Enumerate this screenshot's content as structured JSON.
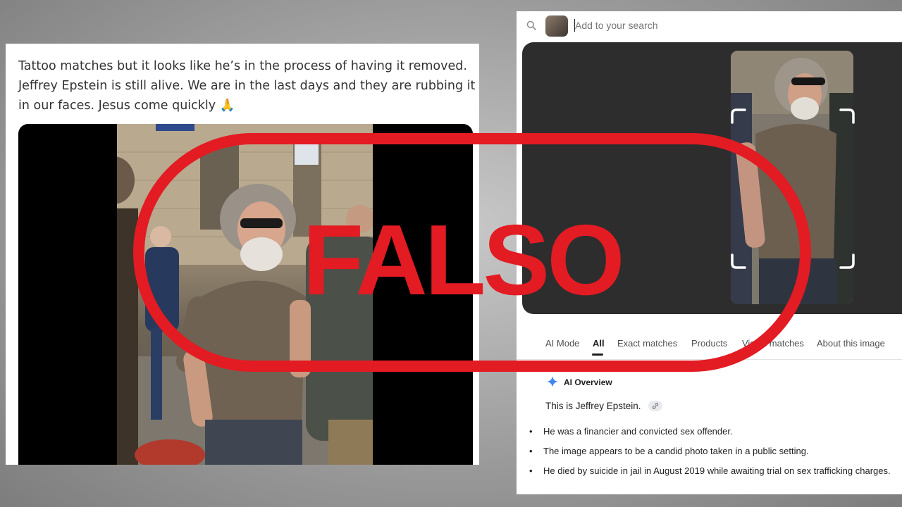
{
  "tweet": {
    "lines": [
      "Tattoo matches but it looks like he’s in the process of having it removed.",
      "Jeffrey Epstein is still alive. We are in the last days and they are rubbing it",
      "in our faces. Jesus come quickly 🙏"
    ]
  },
  "search": {
    "placeholder": "Add to your search",
    "tabs": [
      {
        "label": "AI Mode",
        "active": false
      },
      {
        "label": "All",
        "active": true
      },
      {
        "label": "Exact matches",
        "active": false
      },
      {
        "label": "Products",
        "active": false
      },
      {
        "label": "Visual matches",
        "active": false
      },
      {
        "label": "About this image",
        "active": false
      }
    ],
    "ai_overview": {
      "title": "AI Overview",
      "intro": "This is Jeffrey Epstein.",
      "bullets": [
        "He was a financier and convicted sex offender.",
        "The image appears to be a candid photo taken in a public setting.",
        "He died by suicide in jail in August 2019 while awaiting trial on sex trafficking charges."
      ]
    }
  },
  "stamp": {
    "text": "FALSO",
    "color": "#e31b23"
  },
  "colors": {
    "accent_blue": "#4285f4",
    "stamp_red": "#e31b23"
  }
}
